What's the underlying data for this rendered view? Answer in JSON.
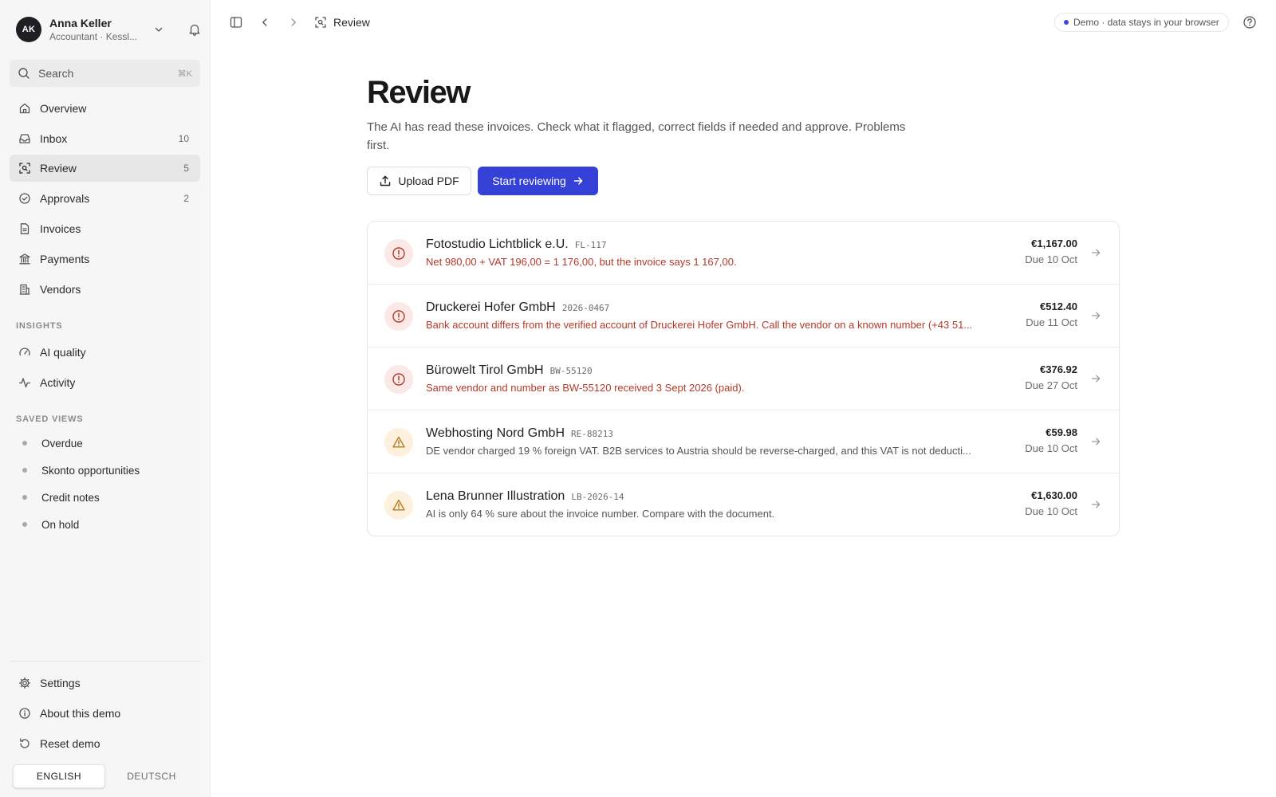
{
  "user": {
    "initials": "AK",
    "name": "Anna Keller",
    "role": "Accountant · Kessl..."
  },
  "search": {
    "label": "Search",
    "shortcut": "⌘K"
  },
  "nav": [
    {
      "label": "Overview",
      "icon": "home-icon",
      "count": ""
    },
    {
      "label": "Inbox",
      "icon": "inbox-icon",
      "count": "10"
    },
    {
      "label": "Review",
      "icon": "scan-icon",
      "count": "5",
      "active": true
    },
    {
      "label": "Approvals",
      "icon": "check-circle-icon",
      "count": "2"
    },
    {
      "label": "Invoices",
      "icon": "document-icon",
      "count": ""
    },
    {
      "label": "Payments",
      "icon": "bank-icon",
      "count": ""
    },
    {
      "label": "Vendors",
      "icon": "building-icon",
      "count": ""
    }
  ],
  "insights": {
    "label": "INSIGHTS",
    "items": [
      {
        "label": "AI quality",
        "icon": "gauge-icon"
      },
      {
        "label": "Activity",
        "icon": "activity-icon"
      }
    ]
  },
  "saved_views": {
    "label": "SAVED VIEWS",
    "items": [
      "Overdue",
      "Skonto opportunities",
      "Credit notes",
      "On hold"
    ]
  },
  "footer": {
    "settings": "Settings",
    "about": "About this demo",
    "reset": "Reset demo",
    "languages": [
      "ENGLISH",
      "DEUTSCH"
    ],
    "active_language": "ENGLISH"
  },
  "topbar": {
    "breadcrumb": "Review",
    "demo_badge": "Demo · data stays in your browser"
  },
  "page": {
    "title": "Review",
    "subtitle": "The AI has read these invoices. Check what it flagged, correct fields if needed and approve. Problems first.",
    "upload_label": "Upload PDF",
    "start_label": "Start reviewing"
  },
  "invoices": [
    {
      "severity": "error",
      "vendor": "Fotostudio Lichtblick e.U.",
      "ref": "FL-117",
      "message": "Net 980,00 + VAT 196,00 = 1 176,00, but the invoice says 1 167,00.",
      "amount": "€1,167.00",
      "due": "Due 10 Oct"
    },
    {
      "severity": "error",
      "vendor": "Druckerei Hofer GmbH",
      "ref": "2026-0467",
      "message": "Bank account differs from the verified account of Druckerei Hofer GmbH. Call the vendor on a known number (+43 51...",
      "amount": "€512.40",
      "due": "Due 11 Oct"
    },
    {
      "severity": "error",
      "vendor": "Bürowelt Tirol GmbH",
      "ref": "BW-55120",
      "message": "Same vendor and number as BW-55120 received 3 Sept 2026 (paid).",
      "amount": "€376.92",
      "due": "Due 27 Oct"
    },
    {
      "severity": "warning",
      "vendor": "Webhosting Nord GmbH",
      "ref": "RE-88213",
      "message": "DE vendor charged 19 % foreign VAT. B2B services to Austria should be reverse-charged, and this VAT is not deducti...",
      "amount": "€59.98",
      "due": "Due 10 Oct"
    },
    {
      "severity": "warning",
      "vendor": "Lena Brunner Illustration",
      "ref": "LB-2026-14",
      "message": "AI is only 64 % sure about the invoice number. Compare with the document.",
      "amount": "€1,630.00",
      "due": "Due 10 Oct"
    }
  ],
  "colors": {
    "accent": "#3440d6",
    "error": "#b33a2a",
    "warning": "#b7791f"
  }
}
